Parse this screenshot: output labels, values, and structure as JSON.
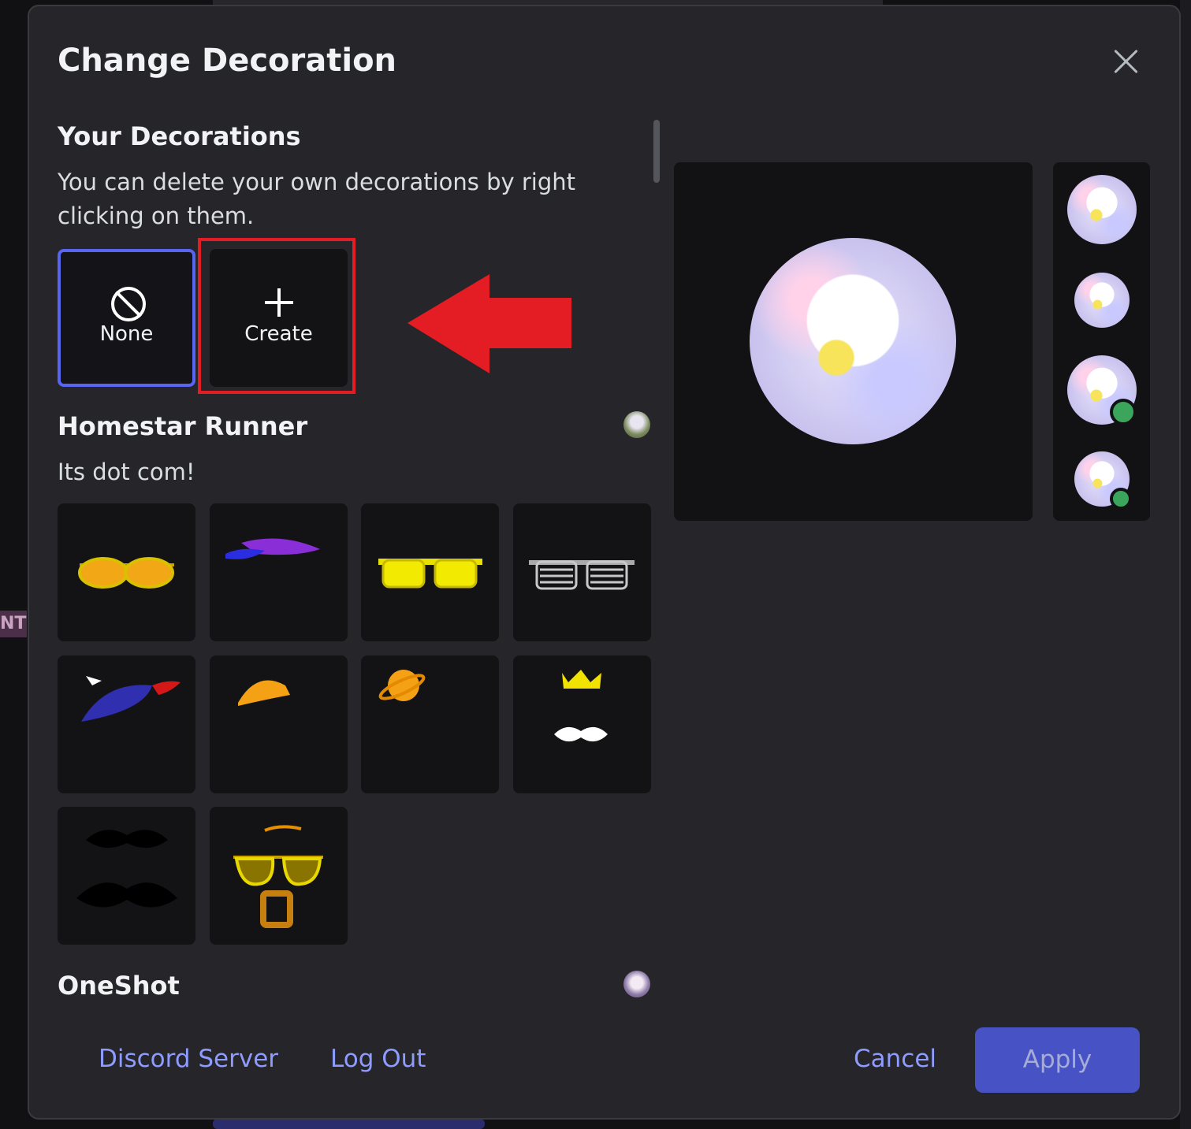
{
  "modal": {
    "title": "Change Decoration"
  },
  "your_decorations": {
    "title": "Your Decorations",
    "description": "You can delete your own decorations by right clicking on them.",
    "none_label": "None",
    "create_label": "Create"
  },
  "packs": [
    {
      "title": "Homestar Runner",
      "description": "Its dot com!",
      "items": [
        "aviator-sunglasses",
        "purple-cap",
        "yellow-square-glasses",
        "shutter-shades",
        "propeller-cap",
        "orange-hardhat",
        "orange-planet-hat",
        "crown-and-mustache",
        "black-mustaches",
        "yellow-glasses-beard"
      ]
    },
    {
      "title": "OneShot",
      "description": "",
      "items": []
    }
  ],
  "footer": {
    "discord_server": "Discord Server",
    "log_out": "Log Out",
    "cancel": "Cancel",
    "apply": "Apply"
  },
  "colors": {
    "accent": "#5865f2",
    "highlight": "#e41c24",
    "online": "#3ba55c",
    "link": "#8e9cff"
  }
}
